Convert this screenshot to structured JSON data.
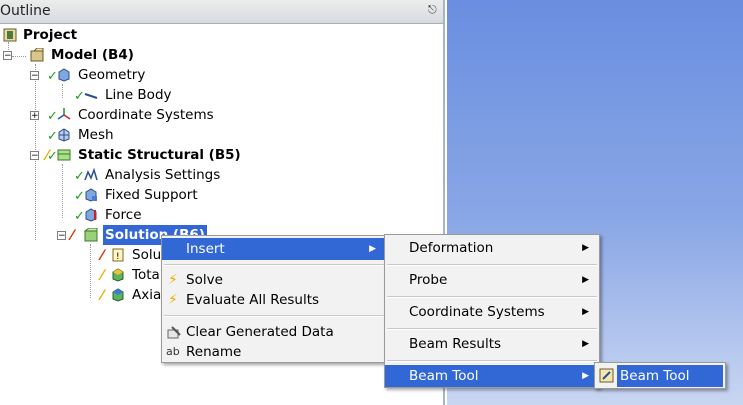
{
  "outline": {
    "title": "Outline",
    "pin": "↪"
  },
  "tree": {
    "project": "Project",
    "model": "Model (B4)",
    "geometry": "Geometry",
    "line_body": "Line Body",
    "coordinate_systems": "Coordinate Systems",
    "mesh": "Mesh",
    "static_structural": "Static Structural (B5)",
    "analysis_settings": "Analysis Settings",
    "fixed_support": "Fixed Support",
    "force": "Force",
    "solution": "Solution (B6)",
    "solution_info": "Solut",
    "total_deformation": "Tota",
    "axial": "Axial"
  },
  "context_menu": {
    "insert": "Insert",
    "solve": "Solve",
    "evaluate_all": "Evaluate All Results",
    "clear_generated": "Clear Generated Data",
    "rename": "Rename"
  },
  "insert_submenu": {
    "deformation": "Deformation",
    "probe": "Probe",
    "coordinate_systems": "Coordinate Systems",
    "beam_results": "Beam Results",
    "beam_tool": "Beam Tool"
  },
  "beam_tool_submenu": {
    "beam_tool": "Beam Tool"
  },
  "colors": {
    "selection": "#3168d5",
    "viewport_top": "#6a8ee0",
    "viewport_bottom": "#c9d6f2"
  }
}
